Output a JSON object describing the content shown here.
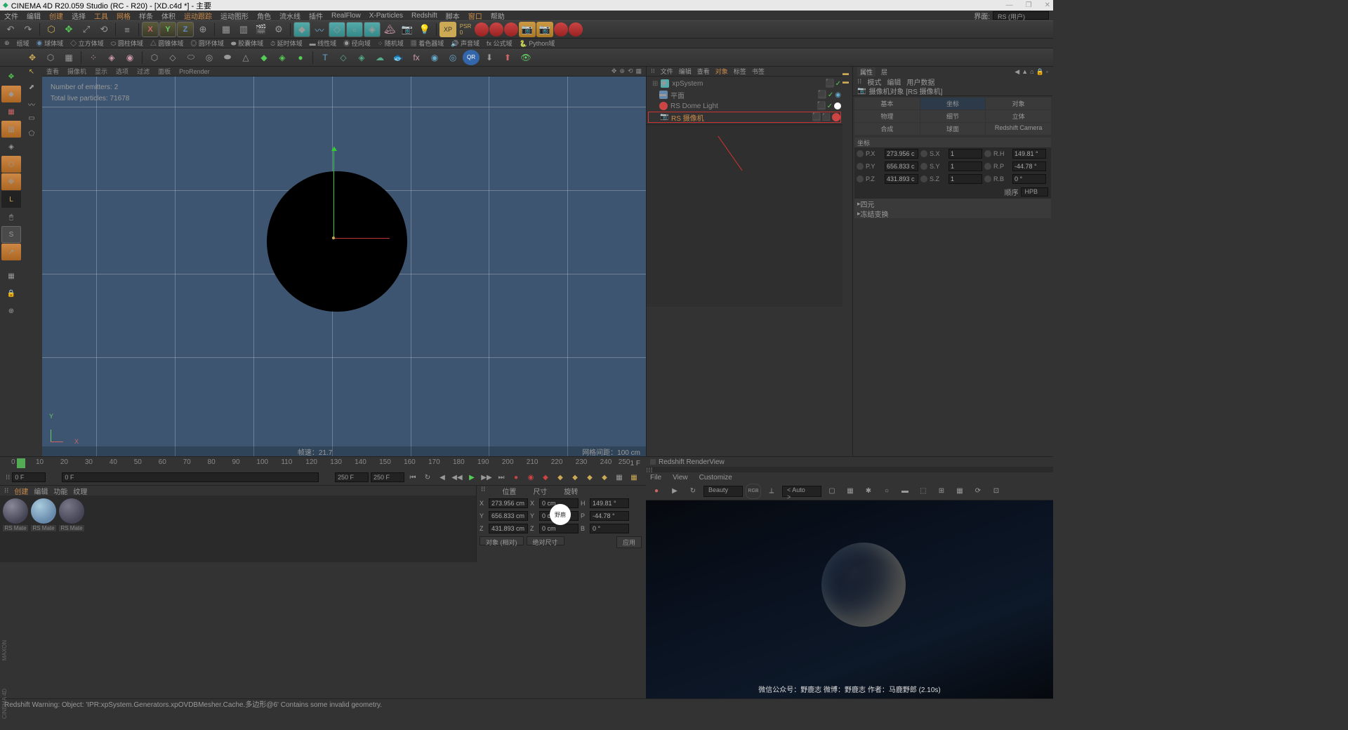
{
  "title": "CINEMA 4D R20.059 Studio (RC - R20) - [XD.c4d *] - 主要",
  "menubar": [
    "文件",
    "编辑",
    "创建",
    "选择",
    "工具",
    "网格",
    "样条",
    "体积",
    "运动跟踪",
    "运动图形",
    "角色",
    "流水线",
    "插件",
    "RealFlow",
    "X-Particles",
    "Redshift",
    "脚本",
    "窗口",
    "帮助"
  ],
  "layout_label": "界面:",
  "layout_value": "RS (用户)",
  "toolbar2": [
    "组域",
    "球体域",
    "立方体域",
    "圆柱体域",
    "圆锥体域",
    "圆环体域",
    "胶囊体域",
    "延时体域",
    "线性域",
    "径向域",
    "随机域",
    "着色器域",
    "声音域",
    "公式域",
    "Python域"
  ],
  "viewport": {
    "tabs": [
      "查看",
      "摄像机",
      "显示",
      "选项",
      "过滤",
      "面板",
      "ProRender"
    ],
    "emitter_info": "Number of emitters: 2",
    "particle_info": "Total live particles: 71678",
    "fps": "帧速：21.7",
    "gridspacing": "网格间距：100 cm"
  },
  "objects": {
    "tabs": [
      "文件",
      "编辑",
      "查看",
      "对象",
      "标签",
      "书签"
    ],
    "list": [
      {
        "name": "xpSystem",
        "color": "#5aa"
      },
      {
        "name": "平面",
        "color": "#68a"
      },
      {
        "name": "RS Dome Light",
        "color": "#c44"
      },
      {
        "name": "RS 摄像机",
        "color": "#c44",
        "selected": true
      }
    ]
  },
  "attributes": {
    "tabs": [
      "属性",
      "层"
    ],
    "modetabs": [
      "模式",
      "编辑",
      "用户数据"
    ],
    "header": "摄像机对象 [RS 摄像机]",
    "tabrow1": [
      "基本",
      "坐标",
      "对象"
    ],
    "tabrow2": [
      "物理",
      "细节",
      "立体"
    ],
    "tabrow3": [
      "合成",
      "球面",
      "Redshift Camera"
    ],
    "section_coord": "坐标",
    "coords": {
      "px": "273.956 c",
      "sx": "1",
      "rh": "149.81 °",
      "py": "656.833 c",
      "sy": "1",
      "rp": "-44.78 °",
      "pz": "431.893 c",
      "sz": "1",
      "rb": "0 °"
    },
    "sort_label": "顺序",
    "sort_value": "HPB",
    "section_quat": "四元",
    "section_freeze": "冻结变换"
  },
  "rsview": {
    "title": "Redshift RenderView",
    "menus": [
      "File",
      "View",
      "Customize"
    ],
    "aov": "Beauty",
    "auto": "< Auto >",
    "credit": "微信公众号：野鹿志   微博：野鹿志   作者：马鹿野郎   (2.10s)"
  },
  "timeline": {
    "marks": [
      "0",
      "10",
      "20",
      "30",
      "40",
      "50",
      "60",
      "70",
      "80",
      "90",
      "100",
      "110",
      "120",
      "130",
      "140",
      "150",
      "160",
      "170",
      "180",
      "190",
      "200",
      "210",
      "220",
      "230",
      "240",
      "250"
    ],
    "start": "0 F",
    "end": "250 F",
    "cur": "0 F",
    "max": "250 F",
    "endlabel": "1 F"
  },
  "materials": {
    "tabs": [
      "创建",
      "编辑",
      "功能",
      "纹理"
    ],
    "items": [
      "RS Mate",
      "RS Mate",
      "RS Mate"
    ]
  },
  "coordpanel": {
    "tabs": [
      "位置",
      "尺寸",
      "旋转"
    ],
    "x": "273.956 cm",
    "xs": "0 cm",
    "xh": "149.81 °",
    "y": "656.833 cm",
    "ys": "0 cm",
    "yp": "-44.78 °",
    "z": "431.893 cm",
    "zs": "0 cm",
    "zb": "0 °",
    "modes": [
      "对象 (相对)",
      "绝对尺寸"
    ],
    "apply": "应用"
  },
  "status": "Redshift Warning: Object: 'IPR:xpSystem.Generators.xpOVDBMesher.Cache.多边形@6' Contains some invalid geometry."
}
